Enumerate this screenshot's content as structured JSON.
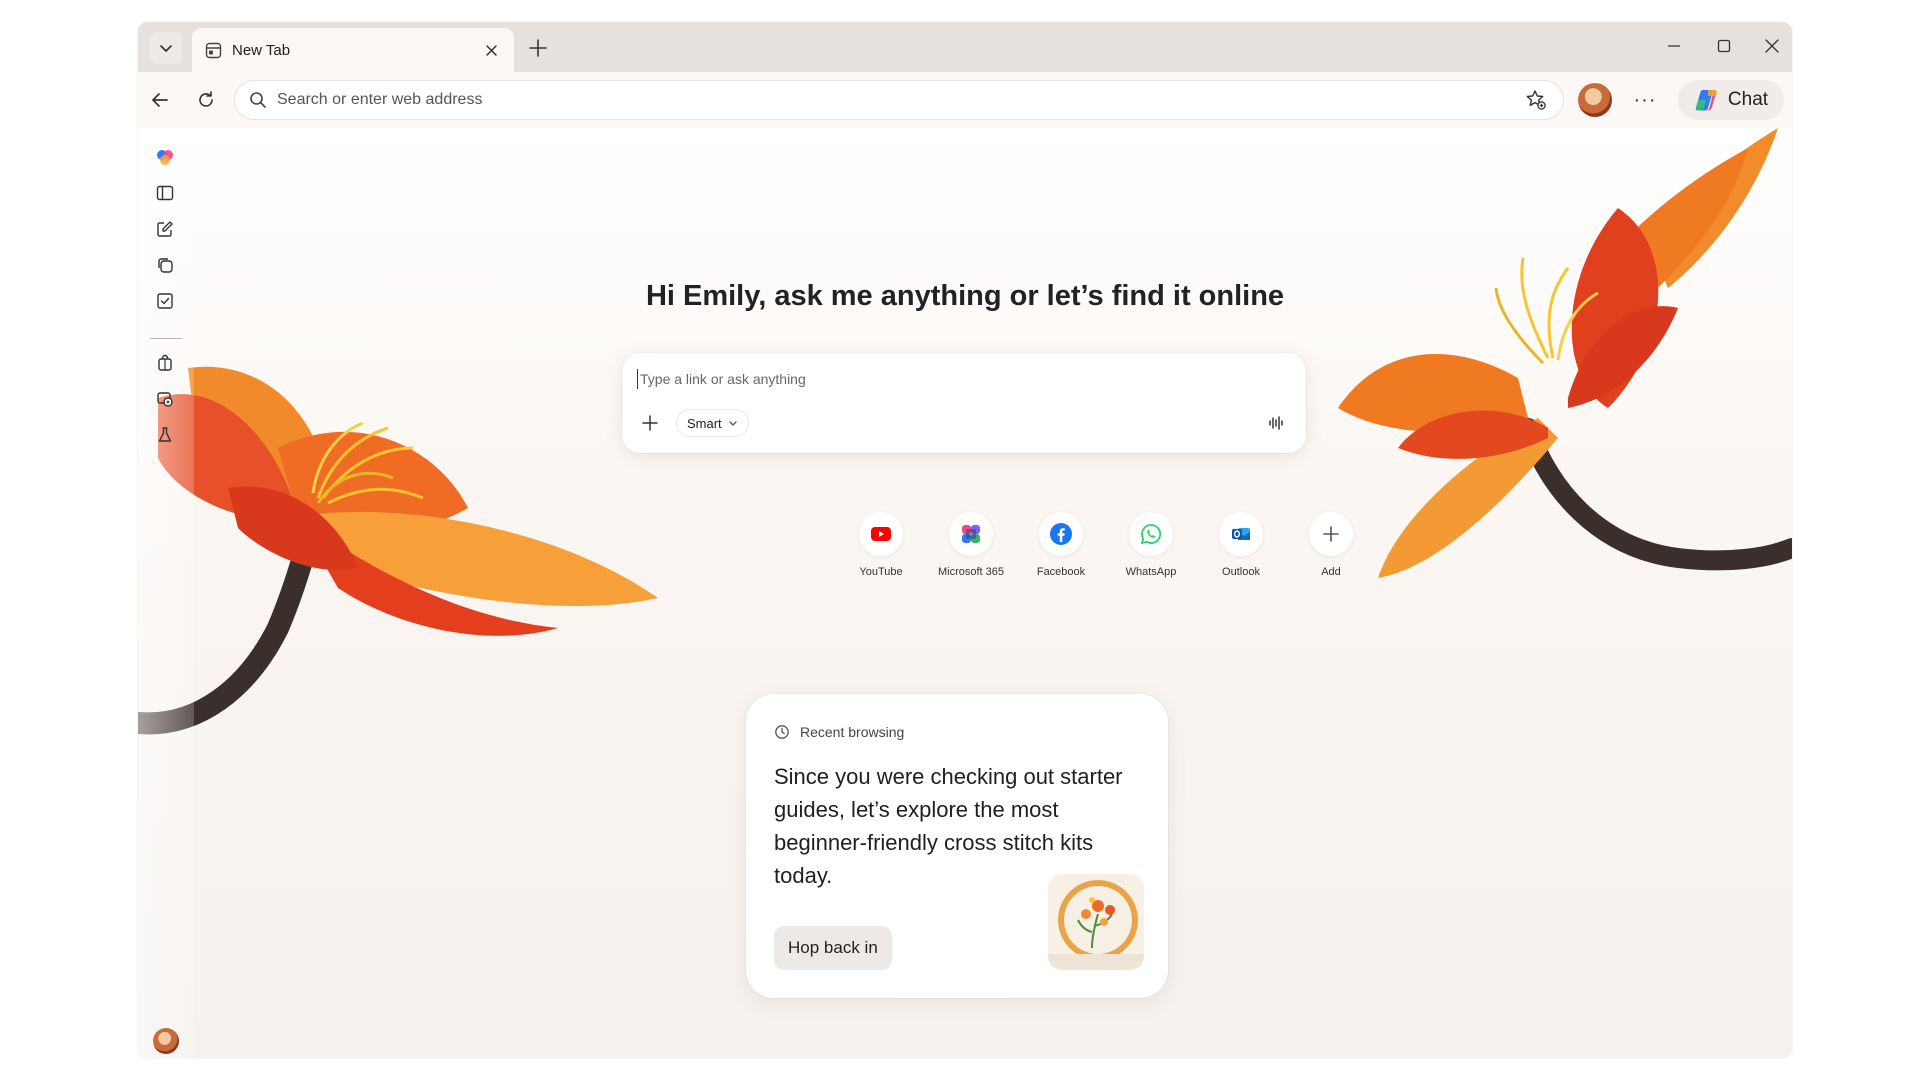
{
  "browser": {
    "tab": {
      "title": "New Tab"
    },
    "address_bar": {
      "placeholder": "Search or enter web address"
    },
    "chat_button": {
      "label": "Chat"
    },
    "more_button": {
      "label": "···"
    }
  },
  "new_tab_page": {
    "greeting": "Hi Emily, ask me anything or let’s find it online",
    "search": {
      "placeholder": "Type a link or ask anything",
      "mode": "Smart"
    },
    "shortcuts": [
      {
        "label": "YouTube",
        "icon": "youtube-icon",
        "color": "#ff0000"
      },
      {
        "label": "Microsoft 365",
        "icon": "microsoft-365-icon",
        "color": "#7b61ff"
      },
      {
        "label": "Facebook",
        "icon": "facebook-icon",
        "color": "#1877f2"
      },
      {
        "label": "WhatsApp",
        "icon": "whatsapp-icon",
        "color": "#25d366"
      },
      {
        "label": "Outlook",
        "icon": "outlook-icon",
        "color": "#0f6cbd"
      },
      {
        "label": "Add",
        "icon": "plus-icon",
        "color": "#555555"
      }
    ],
    "recent_card": {
      "header": "Recent browsing",
      "body": "Since you were checking out starter guides, let’s explore the most beginner-friendly cross stitch kits today.",
      "button": "Hop back in"
    }
  },
  "sidebar": {
    "icons": [
      "copilot-icon",
      "sidebar-panel-icon",
      "compose-icon",
      "collections-icon",
      "tasks-icon",
      "shopping-icon",
      "image-icon",
      "labs-icon"
    ]
  },
  "colors": {
    "accent": "#e9571f",
    "flower_orange": "#f07a22",
    "flower_red": "#e0401e",
    "stem": "#3b2f2b"
  }
}
